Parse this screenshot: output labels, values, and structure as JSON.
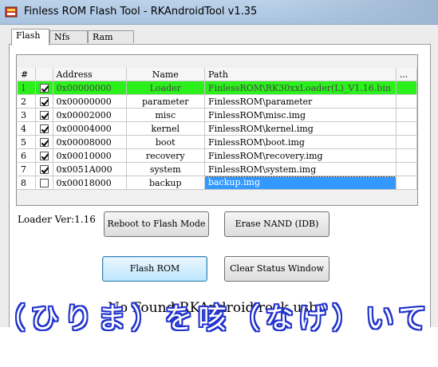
{
  "window": {
    "title": "Finless ROM Flash Tool - RKAndroidTool v1.35"
  },
  "tabs": [
    {
      "label": "Flash"
    },
    {
      "label": "Nfs"
    },
    {
      "label": "Ram"
    }
  ],
  "table": {
    "headers": {
      "num": "#",
      "check": "",
      "address": "Address",
      "name": "Name",
      "path": "Path",
      "more": "..."
    },
    "rows": [
      {
        "num": "1",
        "checked": true,
        "address": "0x00000000",
        "name": "Loader",
        "path": "FinlessROM\\RK30xxLoader(L)_V1.16.bin"
      },
      {
        "num": "2",
        "checked": true,
        "address": "0x00000000",
        "name": "parameter",
        "path": "FinlessROM\\parameter"
      },
      {
        "num": "3",
        "checked": true,
        "address": "0x00002000",
        "name": "misc",
        "path": "FinlessROM\\misc.img"
      },
      {
        "num": "4",
        "checked": true,
        "address": "0x00004000",
        "name": "kernel",
        "path": "FinlessROM\\kernel.img"
      },
      {
        "num": "5",
        "checked": true,
        "address": "0x00008000",
        "name": "boot",
        "path": "FinlessROM\\boot.img"
      },
      {
        "num": "6",
        "checked": true,
        "address": "0x00010000",
        "name": "recovery",
        "path": "FinlessROM\\recovery.img"
      },
      {
        "num": "7",
        "checked": true,
        "address": "0x0051A000",
        "name": "system",
        "path": "FinlessROM\\system.img"
      },
      {
        "num": "8",
        "checked": false,
        "address": "0x00018000",
        "name": "backup",
        "path": "backup.img"
      }
    ],
    "selected_row": "1",
    "highlight_color": "#2bf01c"
  },
  "loader_version": "Loader Ver:1.16",
  "buttons": {
    "reboot": "Reboot to Flash Mode",
    "erase": "Erase NAND (IDB)",
    "flash": "Flash ROM",
    "clear": "Clear Status Window"
  },
  "status_text": "No Found RKAndroid rock usb",
  "overlay_caption": "（ひりま）を咳（なげ）いて"
}
